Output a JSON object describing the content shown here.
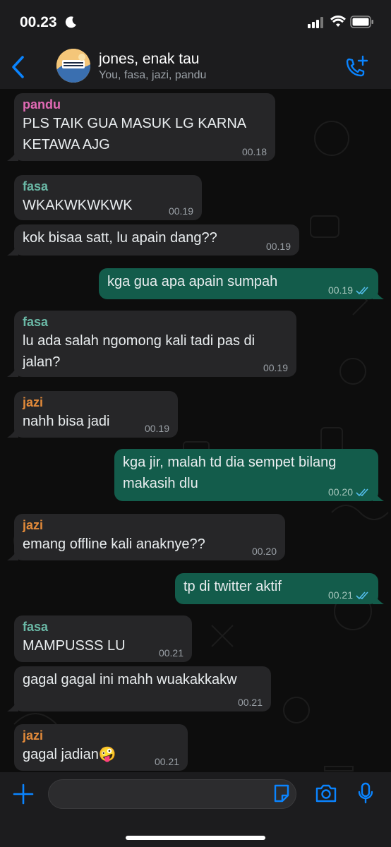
{
  "status_bar": {
    "time": "00.23",
    "icons": [
      "moon-icon",
      "signal-icon",
      "wifi-icon",
      "battery-icon"
    ]
  },
  "header": {
    "title": "jones, enak tau",
    "subtitle": "You, fasa, jazi, pandu",
    "icons": [
      "back-chevron-icon",
      "group-avatar",
      "add-call-icon"
    ]
  },
  "colors": {
    "accent": "#0a84ff",
    "outgoing": "#135c4b",
    "incoming": "#262628",
    "pandu": "#e26ab5",
    "fasa": "#6ab8a6",
    "jazi": "#e48b3a",
    "read_ticks": "#53bdeb"
  },
  "messages": [
    {
      "sender": "pandu",
      "text": "PLS TAIK GUA MASUK LG KARNA KETAWA AJG",
      "time": "00.18"
    },
    {
      "sender": "fasa",
      "text": "WKAKWKWKWK",
      "time": "00.19"
    },
    {
      "sender": "",
      "text": "kok bisaa satt, lu apain dang??",
      "time": "00.19"
    },
    {
      "sender": "",
      "text": "kga gua apa apain sumpah",
      "time": "00.19"
    },
    {
      "sender": "fasa",
      "text": "lu ada salah ngomong kali tadi pas di jalan?",
      "time": "00.19"
    },
    {
      "sender": "jazi",
      "text": "nahh bisa jadi",
      "time": "00.19"
    },
    {
      "sender": "",
      "text": "kga jir, malah td dia sempet bilang makasih dlu",
      "time": "00.20"
    },
    {
      "sender": "jazi",
      "text": "emang offline kali anaknye??",
      "time": "00.20"
    },
    {
      "sender": "",
      "text": "tp di twitter aktif",
      "time": "00.21"
    },
    {
      "sender": "fasa",
      "text": "MAMPUSSS LU",
      "time": "00.21"
    },
    {
      "sender": "",
      "text": "gagal gagal ini mahh wuakakkakw",
      "time": "00.21"
    },
    {
      "sender": "jazi",
      "text": "gagal jadian",
      "emoji": "🤪",
      "time": "00.21"
    }
  ],
  "composer": {
    "placeholder": "",
    "icons": [
      "plus-icon",
      "sticker-icon",
      "camera-icon",
      "mic-icon"
    ]
  }
}
